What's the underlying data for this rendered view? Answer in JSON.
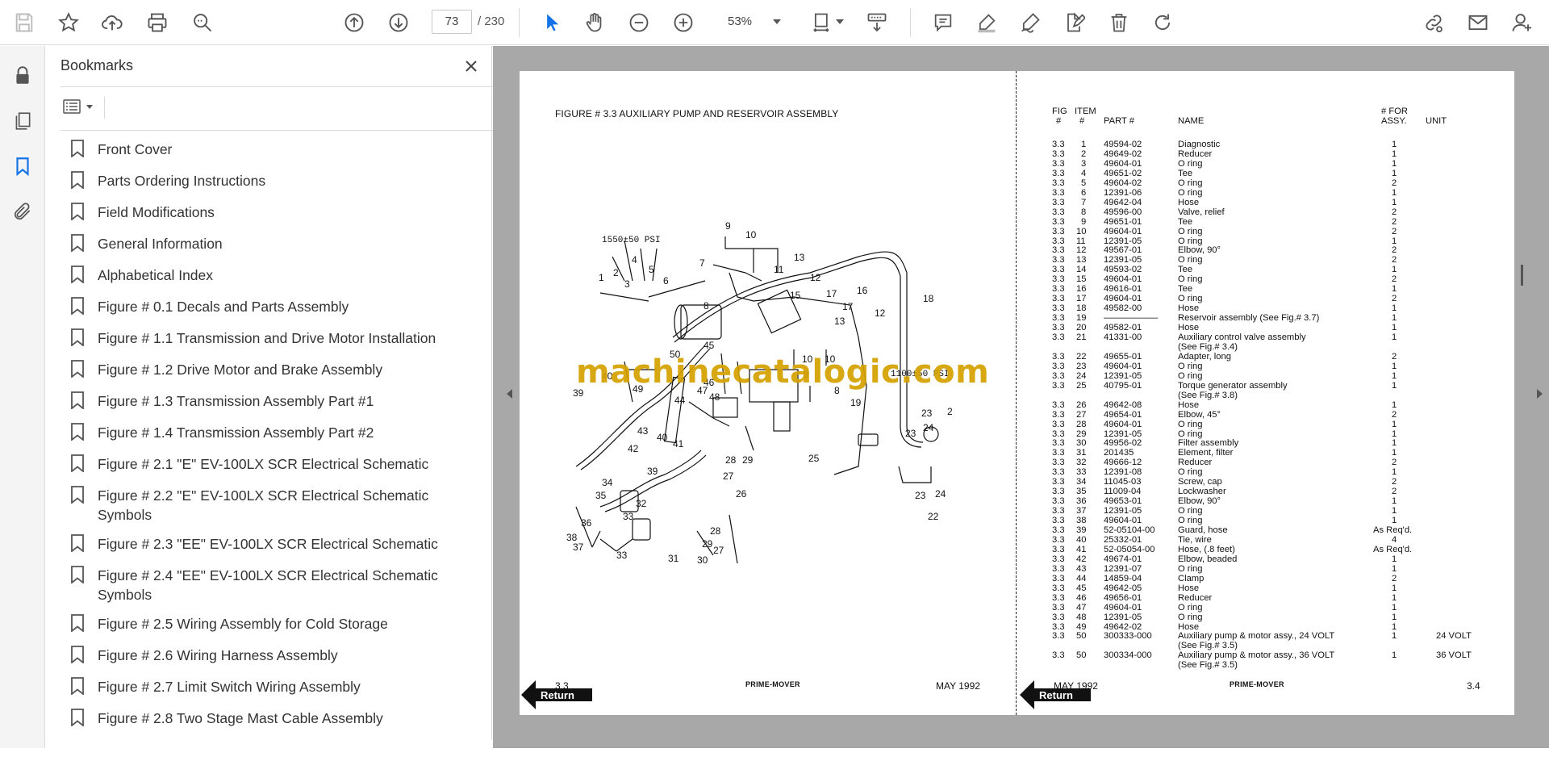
{
  "toolbar": {
    "page_current": "73",
    "page_total": "/ 230",
    "zoom": "53%"
  },
  "bookmarks": {
    "title": "Bookmarks",
    "items": [
      "Front Cover",
      "Parts Ordering Instructions",
      "Field Modifications",
      "General Information",
      "Alphabetical Index",
      "Figure # 0.1 Decals and Parts Assembly",
      "Figure # 1.1 Transmission and Drive Motor Installation",
      "Figure # 1.2 Drive Motor and Brake Assembly",
      "Figure # 1.3 Transmission Assembly Part #1",
      "Figure # 1.4 Transmission Assembly Part #2",
      "Figure # 2.1 \"E\" EV-100LX SCR Electrical Schematic",
      "Figure # 2.2 \"E\" EV-100LX SCR Electrical Schematic Symbols",
      "Figure # 2.3 \"EE\" EV-100LX SCR Electrical Schematic",
      "Figure # 2.4 \"EE\" EV-100LX SCR Electrical Schematic Symbols",
      "Figure # 2.5 Wiring Assembly for Cold Storage",
      "Figure # 2.6 Wiring Harness Assembly",
      "Figure # 2.7 Limit Switch Wiring Assembly",
      "Figure # 2.8 Two Stage Mast Cable Assembly"
    ]
  },
  "document": {
    "figure_title": "FIGURE # 3.3  AUXILIARY PUMP AND RESERVOIR ASSEMBLY",
    "watermark": "machinecatalogic.com",
    "diagram_labels": {
      "psi_top": "1550±50 PSI",
      "psi_right": "1100±50 PSI"
    },
    "table_headers": {
      "fig_top": "FIG",
      "fig_bottom": "#",
      "item_top": "ITEM",
      "item_bottom": "#",
      "part": "PART #",
      "name": "NAME",
      "for_top": "# FOR",
      "for_bottom": "ASSY.",
      "unit": "UNIT"
    },
    "parts": [
      [
        "3.3",
        "1",
        "49594-02",
        "Diagnostic",
        "1",
        ""
      ],
      [
        "3.3",
        "2",
        "49649-02",
        "Reducer",
        "1",
        ""
      ],
      [
        "3.3",
        "3",
        "49604-01",
        "O ring",
        "1",
        ""
      ],
      [
        "3.3",
        "4",
        "49651-02",
        "Tee",
        "1",
        ""
      ],
      [
        "3.3",
        "5",
        "49604-02",
        "O ring",
        "2",
        ""
      ],
      [
        "3.3",
        "6",
        "12391-06",
        "O ring",
        "1",
        ""
      ],
      [
        "3.3",
        "7",
        "49642-04",
        "Hose",
        "1",
        ""
      ],
      [
        "3.3",
        "8",
        "49596-00",
        "Valve, relief",
        "2",
        ""
      ],
      [
        "3.3",
        "9",
        "49651-01",
        "Tee",
        "2",
        ""
      ],
      [
        "3.3",
        "10",
        "49604-01",
        "O ring",
        "2",
        ""
      ],
      [
        "3.3",
        "11",
        "12391-05",
        "O ring",
        "1",
        ""
      ],
      [
        "3.3",
        "12",
        "49567-01",
        "Elbow, 90°",
        "2",
        ""
      ],
      [
        "3.3",
        "13",
        "12391-05",
        "O ring",
        "2",
        ""
      ],
      [
        "3.3",
        "14",
        "49593-02",
        "Tee",
        "1",
        ""
      ],
      [
        "3.3",
        "15",
        "49604-01",
        "O ring",
        "2",
        ""
      ],
      [
        "3.3",
        "16",
        "49616-01",
        "Tee",
        "1",
        ""
      ],
      [
        "3.3",
        "17",
        "49604-01",
        "O ring",
        "2",
        ""
      ],
      [
        "3.3",
        "18",
        "49582-00",
        "Hose",
        "1",
        ""
      ],
      [
        "3.3",
        "19",
        "——————",
        "Reservoir assembly (See Fig.# 3.7)",
        "1",
        ""
      ],
      [
        "3.3",
        "20",
        "49582-01",
        "Hose",
        "1",
        ""
      ],
      [
        "3.3",
        "21",
        "41331-00",
        "Auxiliary control valve assembly",
        "1",
        ""
      ],
      [
        "",
        "",
        "",
        "(See Fig.# 3.4)",
        "",
        ""
      ],
      [
        "3.3",
        "22",
        "49655-01",
        "Adapter, long",
        "2",
        ""
      ],
      [
        "3.3",
        "23",
        "49604-01",
        "O ring",
        "1",
        ""
      ],
      [
        "3.3",
        "24",
        "12391-05",
        "O ring",
        "1",
        ""
      ],
      [
        "3.3",
        "25",
        "40795-01",
        "Torque generator assembly",
        "1",
        ""
      ],
      [
        "",
        "",
        "",
        "(See Fig.# 3.8)",
        "",
        ""
      ],
      [
        "3.3",
        "26",
        "49642-08",
        "Hose",
        "1",
        ""
      ],
      [
        "3.3",
        "27",
        "49654-01",
        "Elbow, 45°",
        "2",
        ""
      ],
      [
        "3.3",
        "28",
        "49604-01",
        "O ring",
        "1",
        ""
      ],
      [
        "3.3",
        "29",
        "12391-05",
        "O ring",
        "1",
        ""
      ],
      [
        "3.3",
        "30",
        "49956-02",
        "Filter assembly",
        "1",
        ""
      ],
      [
        "3.3",
        "31",
        "201435",
        "Element, filter",
        "1",
        ""
      ],
      [
        "3.3",
        "32",
        "49666-12",
        "Reducer",
        "2",
        ""
      ],
      [
        "3.3",
        "33",
        "12391-08",
        "O ring",
        "1",
        ""
      ],
      [
        "3.3",
        "34",
        "11045-03",
        "Screw, cap",
        "2",
        ""
      ],
      [
        "3.3",
        "35",
        "11009-04",
        "Lockwasher",
        "2",
        ""
      ],
      [
        "3.3",
        "36",
        "49653-01",
        "Elbow, 90°",
        "1",
        ""
      ],
      [
        "3.3",
        "37",
        "12391-05",
        "O ring",
        "1",
        ""
      ],
      [
        "3.3",
        "38",
        "49604-01",
        "O ring",
        "1",
        ""
      ],
      [
        "3.3",
        "39",
        "52-05104-00",
        "Guard, hose",
        "As Req'd.",
        ""
      ],
      [
        "3.3",
        "40",
        "25332-01",
        "Tie, wire",
        "4",
        ""
      ],
      [
        "3.3",
        "41",
        "52-05054-00",
        "Hose, (.8 feet)",
        "As Req'd.",
        ""
      ],
      [
        "3.3",
        "42",
        "49674-01",
        "Elbow, beaded",
        "1",
        ""
      ],
      [
        "3.3",
        "43",
        "12391-07",
        "O ring",
        "1",
        ""
      ],
      [
        "3.3",
        "44",
        "14859-04",
        "Clamp",
        "2",
        ""
      ],
      [
        "3.3",
        "45",
        "49642-05",
        "Hose",
        "1",
        ""
      ],
      [
        "3.3",
        "46",
        "49656-01",
        "Reducer",
        "1",
        ""
      ],
      [
        "3.3",
        "47",
        "49604-01",
        "O ring",
        "1",
        ""
      ],
      [
        "3.3",
        "48",
        "12391-05",
        "O ring",
        "1",
        ""
      ],
      [
        "3.3",
        "49",
        "49642-02",
        "Hose",
        "1",
        ""
      ],
      [
        "3.3",
        "50",
        "300333-000",
        "Auxiliary pump & motor assy., 24 VOLT",
        "1",
        "24 VOLT"
      ],
      [
        "",
        "",
        "",
        "(See Fig.# 3.5)",
        "",
        ""
      ],
      [
        "3.3",
        "50",
        "300334-000",
        "Auxiliary pump & motor assy., 36 VOLT",
        "1",
        "36 VOLT"
      ],
      [
        "",
        "",
        "",
        "(See Fig.# 3.5)",
        "",
        ""
      ]
    ],
    "footer_left": {
      "page_no": "3.3",
      "date": "MAY 1992",
      "brand": "PRIME-MOVER",
      "return": "Return"
    },
    "footer_right": {
      "page_no": "3.4",
      "date": "MAY 1992",
      "brand": "PRIME-MOVER",
      "return": "Return"
    }
  },
  "colors": {
    "accent": "#1473e6",
    "watermark": "#d5a100"
  }
}
